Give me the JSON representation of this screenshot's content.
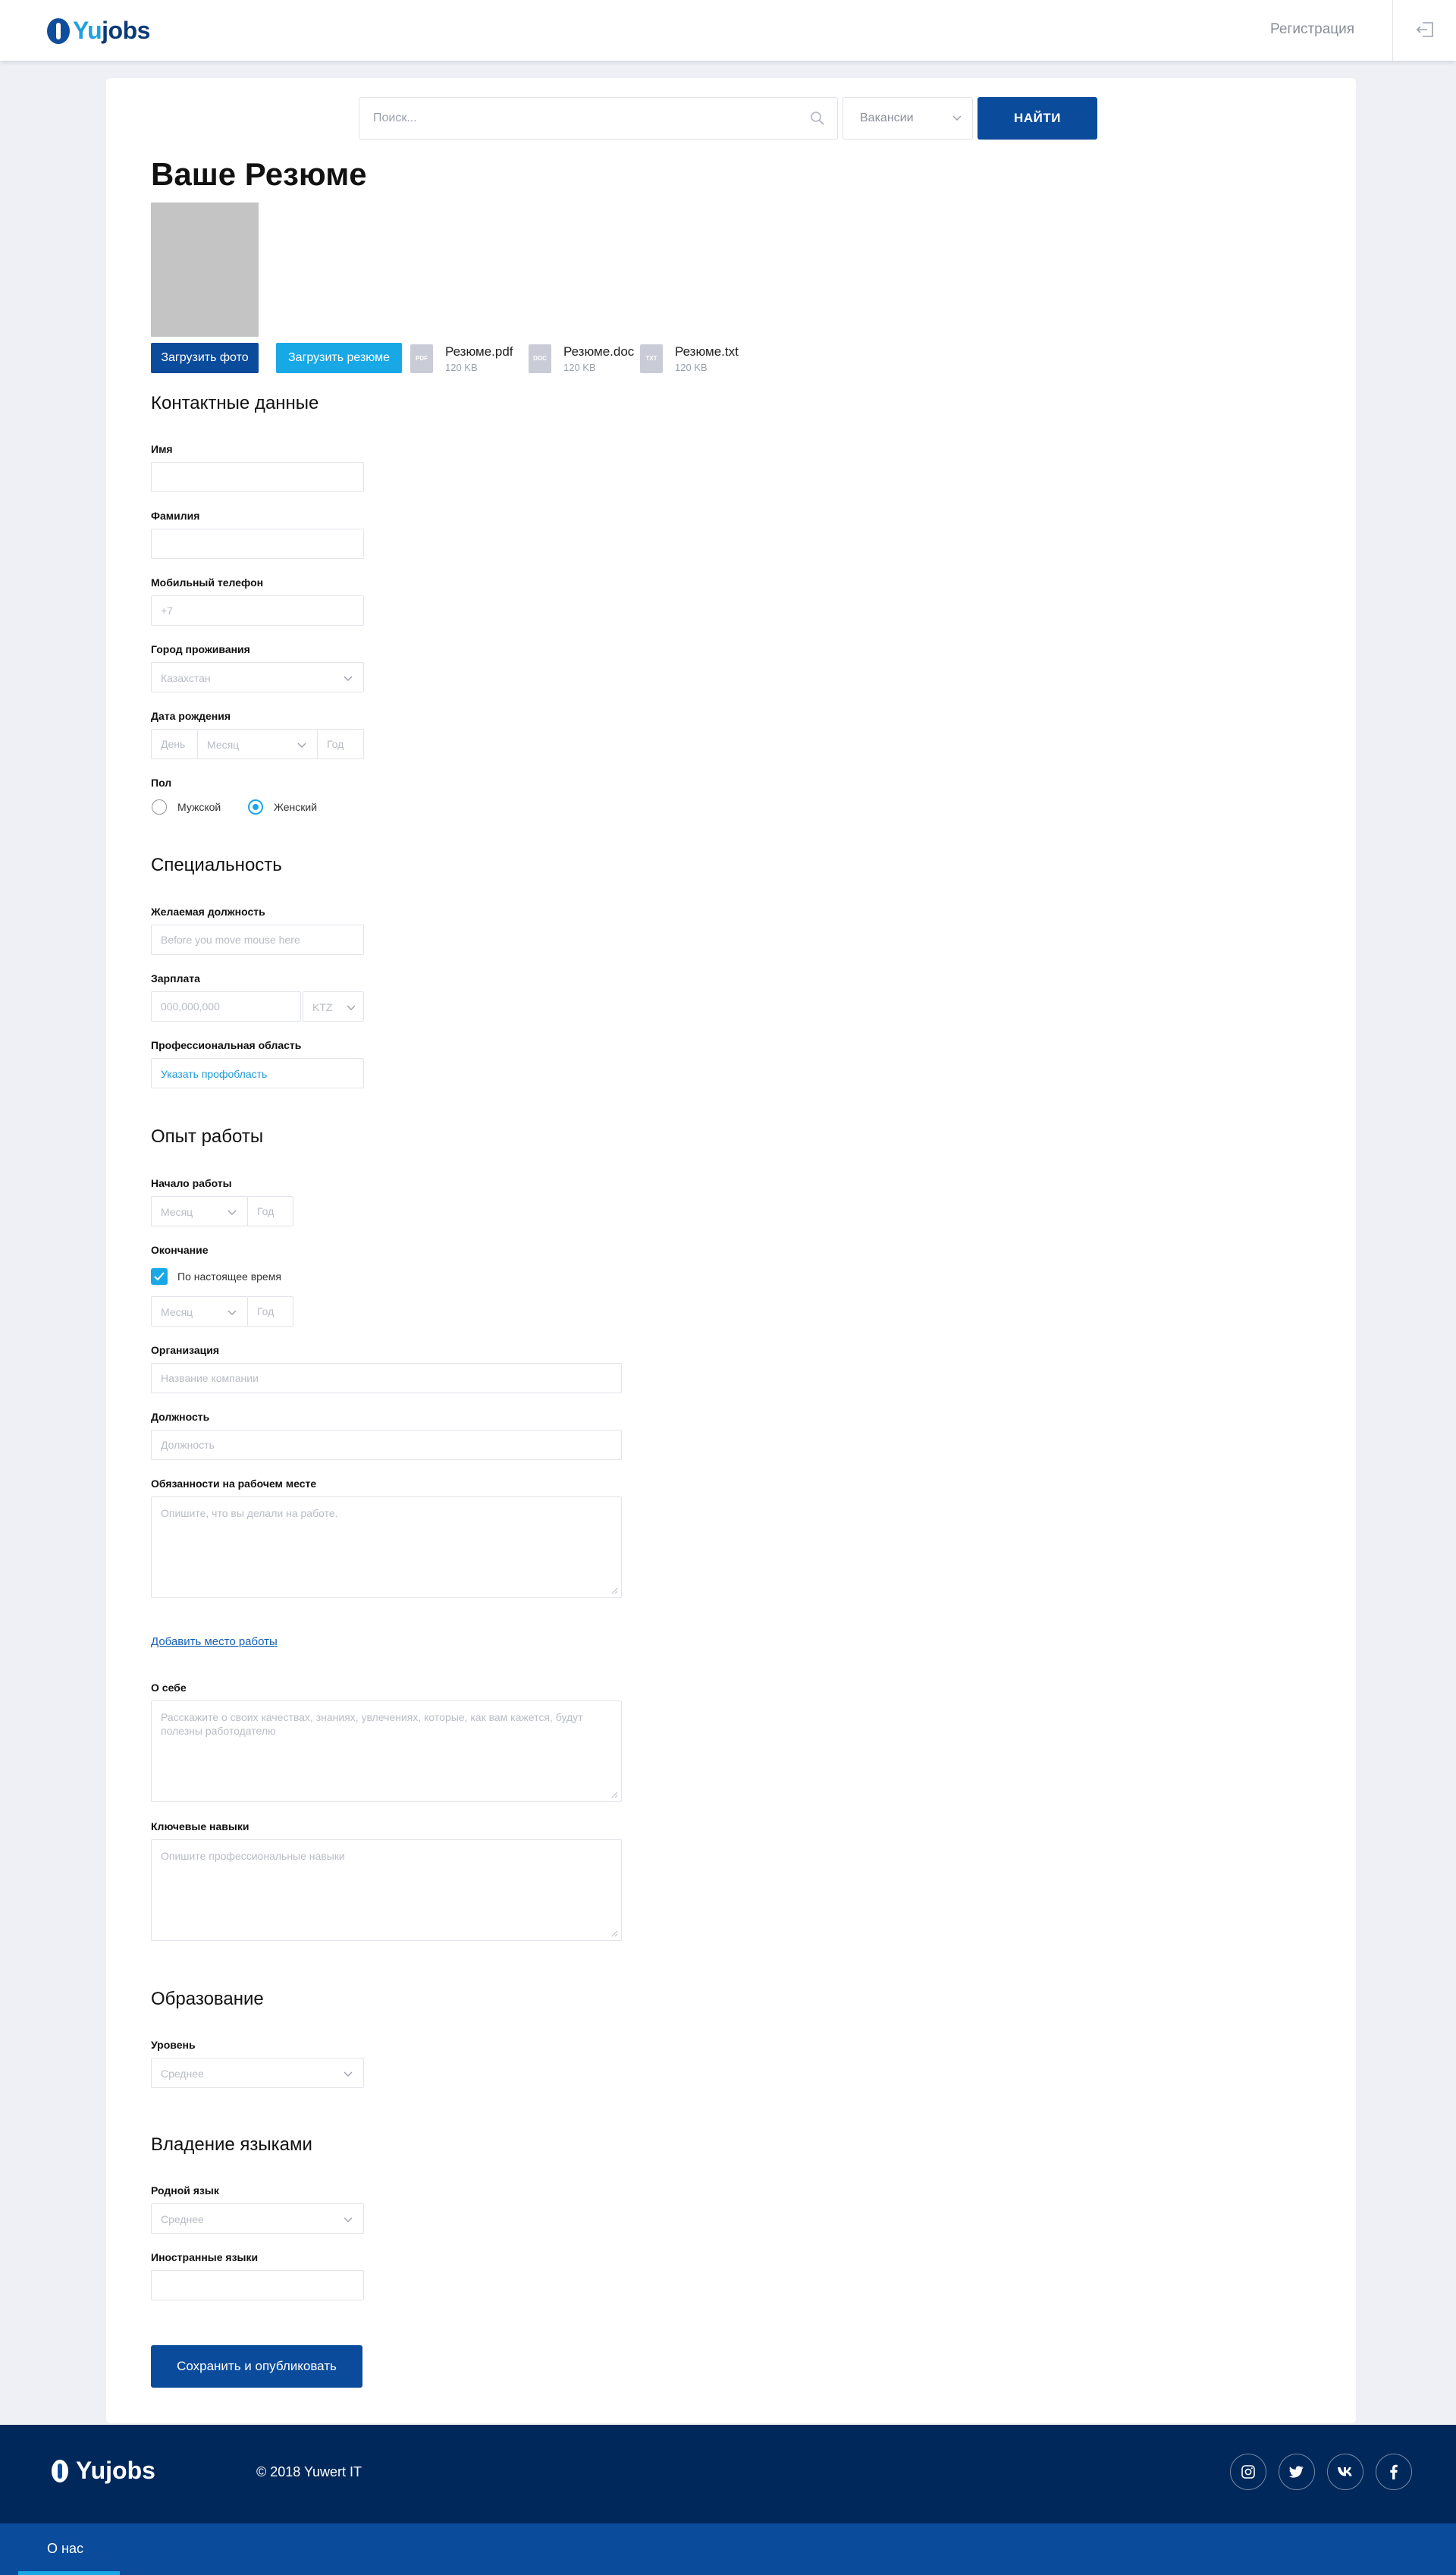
{
  "header": {
    "logo_yu": "Yu",
    "logo_jobs": "jobs",
    "register_link": "Регистрация"
  },
  "search": {
    "placeholder": "Поиск...",
    "type_selected": "Вакансии",
    "find_button": "НАЙТИ"
  },
  "page_title": "Ваше Резюме",
  "upload": {
    "photo_button": "Загрузить фото",
    "resume_button": "Загрузить резюме",
    "files": [
      {
        "badge": "PDF",
        "name": "Резюме.pdf",
        "size": "120 KB"
      },
      {
        "badge": "DOC",
        "name": "Резюме.doc",
        "size": "120 KB"
      },
      {
        "badge": "TXT",
        "name": "Резюме.txt",
        "size": "120 KB"
      }
    ]
  },
  "contacts": {
    "title": "Контактные данные",
    "first_name_label": "Имя",
    "last_name_label": "Фамилия",
    "phone_label": "Мобильный телефон",
    "phone_placeholder": "+7",
    "city_label": "Город проживания",
    "city_value": "Казахстан",
    "birth_label": "Дата рождения",
    "day_placeholder": "День",
    "month_value": "Месяц",
    "year_placeholder": "Год",
    "gender_label": "Пол",
    "gender_male": "Мужской",
    "gender_female": "Женский",
    "gender_selected": "female"
  },
  "specialty": {
    "title": "Специальность",
    "position_label": "Желаемая должность",
    "position_placeholder": "Before you move mouse here",
    "salary_label": "Зарплата",
    "salary_placeholder": "000,000,000",
    "currency_value": "KTZ",
    "area_label": "Профессиональная область",
    "area_link": "Указать профобласть"
  },
  "experience": {
    "title": "Опыт работы",
    "start_label": "Начало работы",
    "month_value": "Месяц",
    "year_placeholder": "Год",
    "end_label": "Окончание",
    "present_label": "По настоящее время",
    "present_checked": true,
    "org_label": "Организация",
    "org_placeholder": "Название компании",
    "job_label": "Должность",
    "job_placeholder": "Должность",
    "duties_label": "Обязанности на рабочем месте",
    "duties_placeholder": "Опишите, что вы делали на работе.",
    "add_link": "Добавить место работы"
  },
  "about": {
    "label": "О себе",
    "placeholder": "Расскажите о своих качествах, знаниях, увлечениях, которые, как вам кажется, будут полезны работодателю",
    "skills_label": "Ключевые навыки",
    "skills_placeholder": "Опишите профессиональные навыки"
  },
  "education": {
    "title": "Образование",
    "level_label": "Уровень",
    "level_value": "Среднее"
  },
  "languages": {
    "title": "Владение языками",
    "native_label": "Родной язык",
    "native_value": "Среднее",
    "foreign_label": "Иностранные языки"
  },
  "save_button": "Сохранить и опубликовать",
  "footer": {
    "logo": "Yujobs",
    "copyright": "© 2018 Yuwert IT",
    "about_link": "О нас",
    "social": [
      "instagram-icon",
      "twitter-icon",
      "vk-icon",
      "facebook-icon"
    ]
  },
  "colors": {
    "primary": "#0a4b9b",
    "accent": "#19a8e6",
    "footer_bg": "#01285b",
    "photo_placeholder": "#c4c4c4"
  }
}
